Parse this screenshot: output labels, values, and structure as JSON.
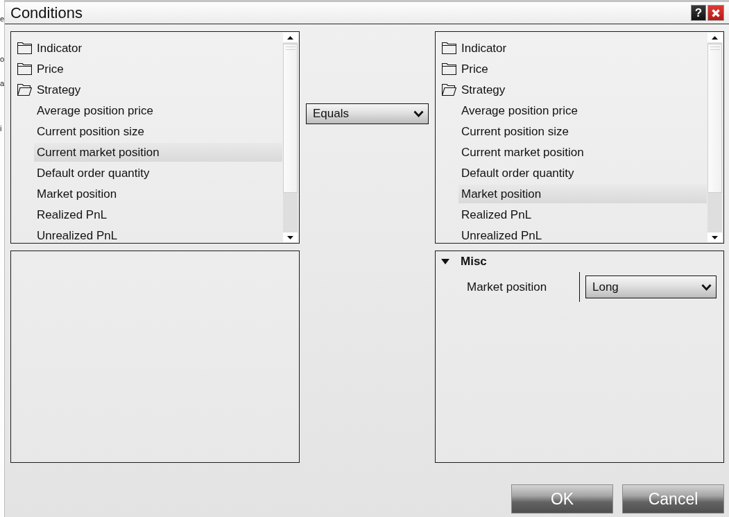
{
  "window": {
    "title": "Conditions",
    "help_button": "?"
  },
  "background_window": {
    "text_fragments": [
      "e",
      "o",
      "a",
      "i"
    ]
  },
  "left_tree": {
    "items": [
      {
        "label": "Indicator",
        "expanded": false,
        "selected": false
      },
      {
        "label": "Price",
        "expanded": false,
        "selected": false
      },
      {
        "label": "Strategy",
        "expanded": true,
        "selected": false,
        "children": [
          {
            "label": "Average position price",
            "selected": false
          },
          {
            "label": "Current position size",
            "selected": false
          },
          {
            "label": "Current market position",
            "selected": true
          },
          {
            "label": "Default order quantity",
            "selected": false
          },
          {
            "label": "Market position",
            "selected": false
          },
          {
            "label": "Realized PnL",
            "selected": false
          },
          {
            "label": "Unrealized PnL",
            "selected": false
          }
        ]
      }
    ]
  },
  "operator": {
    "value": "Equals"
  },
  "right_tree": {
    "items": [
      {
        "label": "Indicator",
        "expanded": false,
        "selected": false
      },
      {
        "label": "Price",
        "expanded": false,
        "selected": false
      },
      {
        "label": "Strategy",
        "expanded": true,
        "selected": false,
        "children": [
          {
            "label": "Average position price",
            "selected": false
          },
          {
            "label": "Current position size",
            "selected": false
          },
          {
            "label": "Current market position",
            "selected": false
          },
          {
            "label": "Default order quantity",
            "selected": false
          },
          {
            "label": "Market position",
            "selected": true
          },
          {
            "label": "Realized PnL",
            "selected": false
          },
          {
            "label": "Unrealized PnL",
            "selected": false
          }
        ]
      }
    ]
  },
  "properties": {
    "categories": [
      {
        "label": "Misc",
        "expanded": true,
        "properties": [
          {
            "label": "Market position",
            "value": "Long"
          }
        ]
      }
    ]
  },
  "buttons": [
    "OK",
    "Cancel"
  ]
}
